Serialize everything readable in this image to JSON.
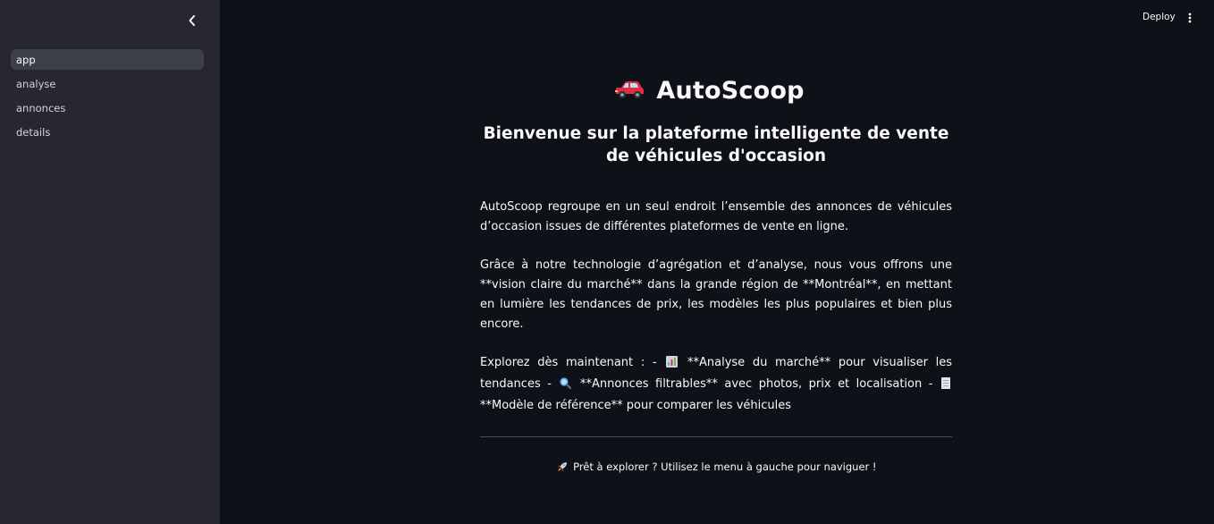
{
  "sidebar": {
    "items": [
      {
        "label": "app",
        "active": true
      },
      {
        "label": "analyse"
      },
      {
        "label": "annonces"
      },
      {
        "label": "details"
      }
    ]
  },
  "header": {
    "deploy_label": "Deploy"
  },
  "main": {
    "title": "AutoScoop",
    "title_icon": "red-car-icon",
    "subtitle": "Bienvenue sur la plateforme intelligente de vente de véhicules d'occasion",
    "paragraph1": "AutoScoop regroupe en un seul endroit l’ensemble des annonces de véhicules d’occasion issues de différentes plateformes de vente en ligne.",
    "paragraph2": "Grâce à notre technologie d’agrégation et d’analyse, nous vous offrons une **vision claire du marché** dans la grande région de **Montréal**, en mettant en lumière les tendances de prix, les modèles les plus populaires et bien plus encore.",
    "paragraph3": {
      "part1": "Explorez dès maintenant : -",
      "part2": "**Analyse du marché** pour visualiser les tendances -",
      "part3": "**Annonces filtrables** avec photos, prix et localisation -",
      "part4": "**Modèle de référence** pour comparer les véhicules",
      "icons": [
        "bar-chart-icon",
        "magnifier-icon",
        "document-icon"
      ]
    },
    "cta": "Prêt à explorer ? Utilisez le menu à gauche pour naviguer !",
    "cta_icon": "rocket-icon"
  },
  "colors": {
    "background": "#0e1117",
    "sidebar": "#262730",
    "active_item": "#3d3f4b",
    "text": "#fafafa"
  }
}
